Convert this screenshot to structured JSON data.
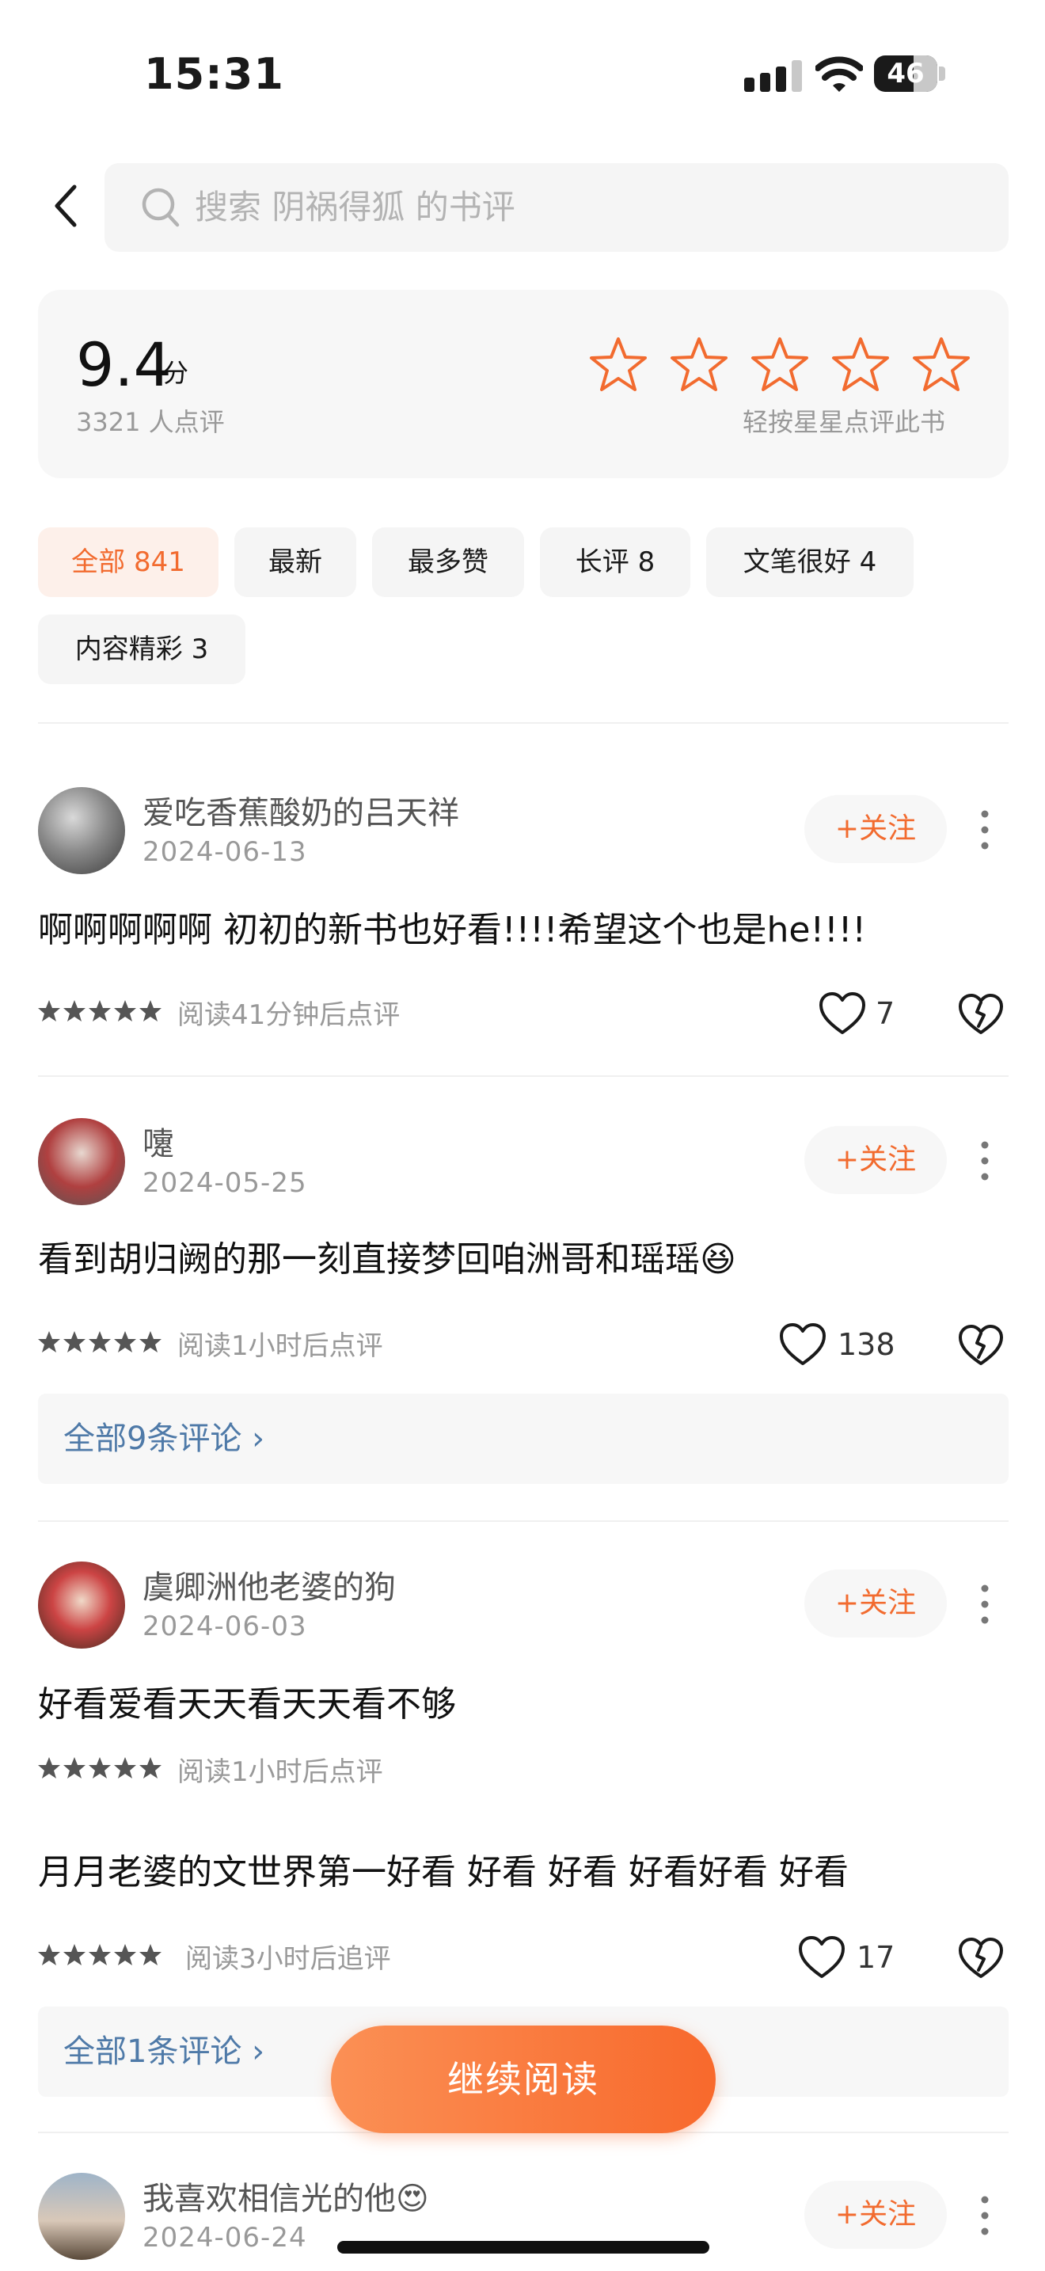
{
  "status_bar": {
    "time": "15:31",
    "battery": "46",
    "battery_level": 0.46
  },
  "search": {
    "placeholder": "搜索 阴祸得狐 的书评"
  },
  "rating": {
    "score": "9.4",
    "unit": "分",
    "count": "3321 人点评",
    "hint": "轻按星星点评此书",
    "stars_total": 5
  },
  "filters": [
    {
      "label": "全部 841",
      "active": true
    },
    {
      "label": "最新",
      "active": false
    },
    {
      "label": "最多赞",
      "active": false
    },
    {
      "label": "长评 8",
      "active": false
    },
    {
      "label": "文笔很好 4",
      "active": false
    },
    {
      "label": "内容精彩 3",
      "active": false
    }
  ],
  "follow_label": "+关注",
  "reviews": [
    {
      "username": "爱吃香蕉酸奶的吕天祥",
      "date": "2024-06-13",
      "content": "啊啊啊啊啊 初初的新书也好看!!!!希望这个也是he!!!!",
      "rating": 5,
      "meta": "阅读41分钟后点评",
      "likes": "7"
    },
    {
      "username": "嚔",
      "date": "2024-05-25",
      "content": "看到胡归阙的那一刻直接梦回咱洲哥和瑶瑶😆",
      "rating": 5,
      "meta": "阅读1小时后点评",
      "likes": "138",
      "comments": "全部9条评论 ›"
    },
    {
      "username": "虞卿洲他老婆的狗",
      "date": "2024-06-03",
      "content": "好看爱看天天看天天看不够",
      "rating": 5,
      "meta": "阅读1小时后点评",
      "followup": {
        "content": "月月老婆的文世界第一好看 好看 好看 好看好看 好看",
        "rating": 5,
        "meta": "阅读3小时后追评"
      },
      "likes": "17",
      "comments": "全部1条评论 ›"
    },
    {
      "username": "我喜欢相信光的他😍",
      "date": "2024-06-24"
    }
  ],
  "continue_button": "继续阅读",
  "colors": {
    "accent": "#f26b2f",
    "link": "#4f7aa8",
    "muted": "#999999"
  },
  "icons": [
    "back-arrow-icon",
    "search-icon",
    "star-outline-icon",
    "more-vertical-icon",
    "heart-outline-icon",
    "broken-heart-icon",
    "star-filled-icon"
  ]
}
